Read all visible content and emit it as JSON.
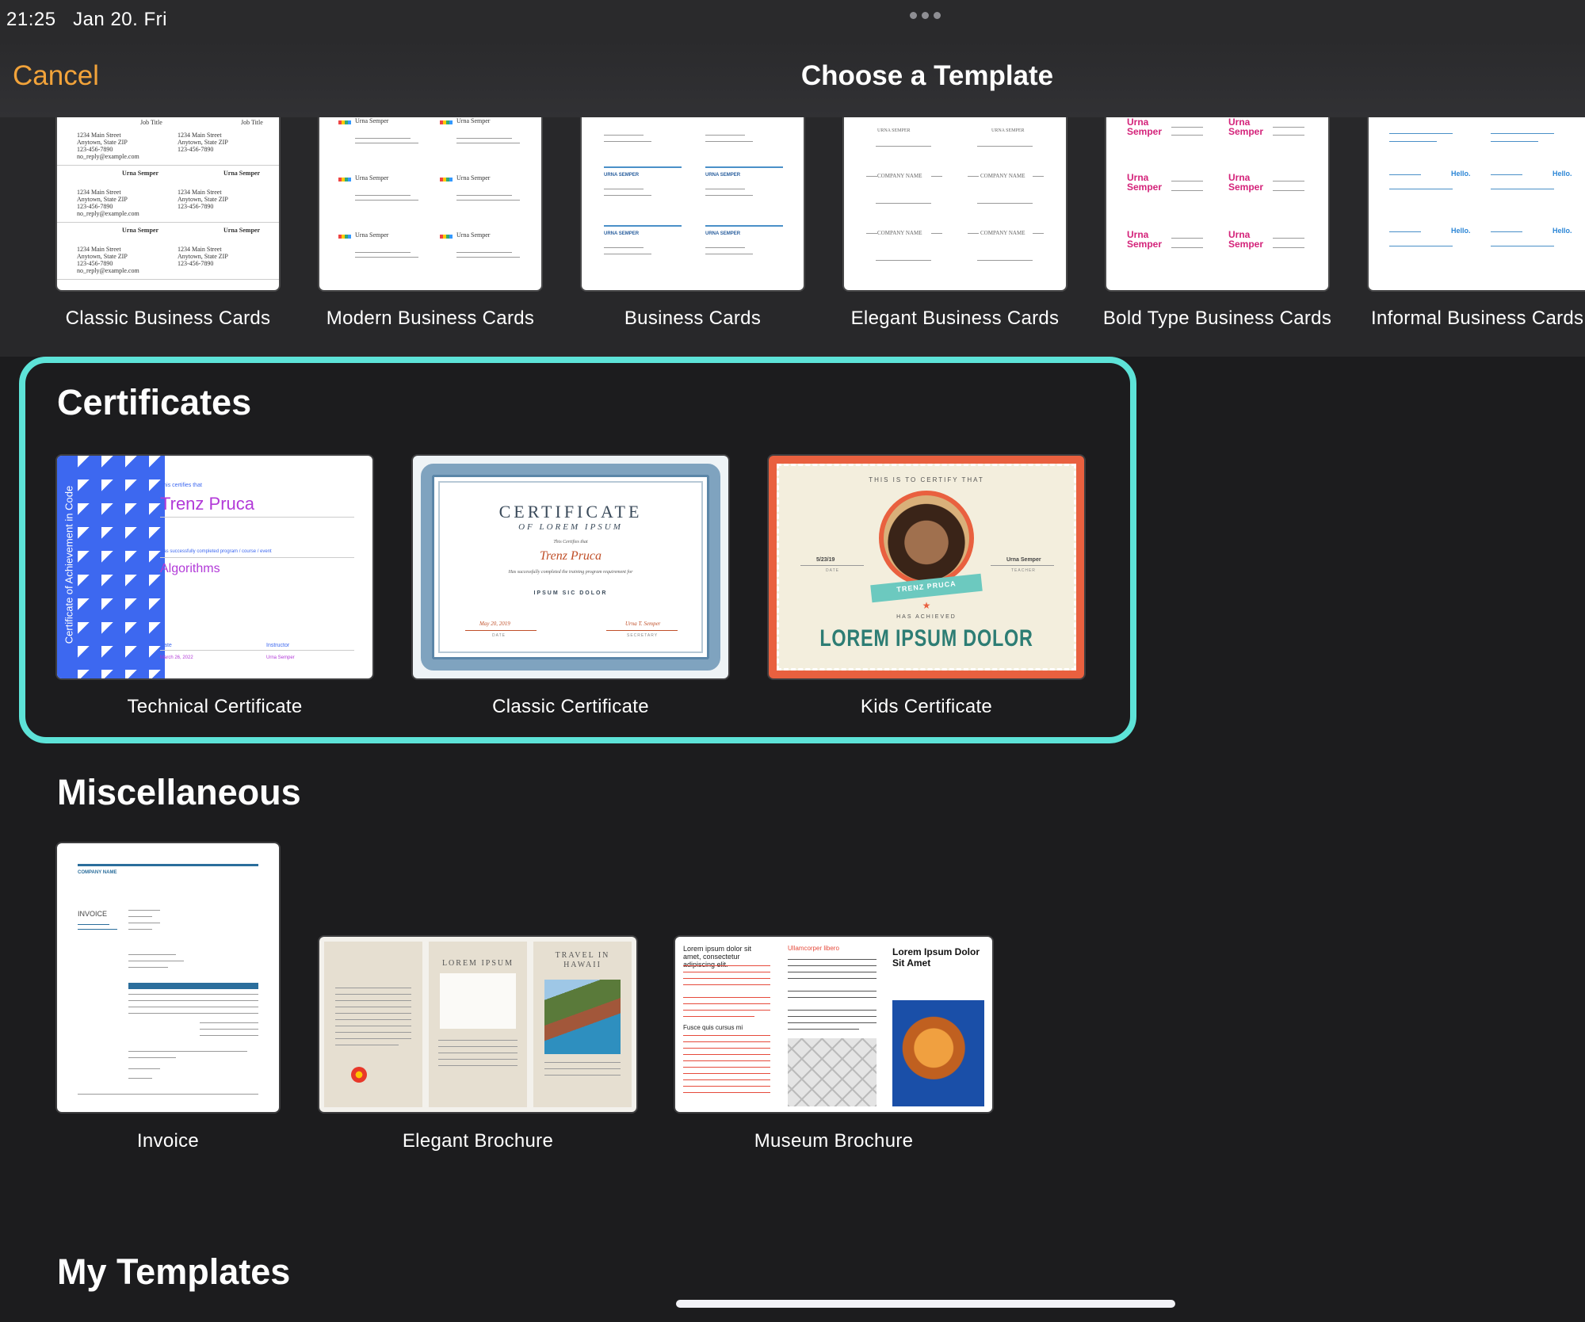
{
  "status": {
    "time": "21:25",
    "date": "Jan 20. Fri"
  },
  "nav": {
    "cancel_label": "Cancel",
    "title": "Choose a Template"
  },
  "business_cards": {
    "items": [
      {
        "label": "Classic Business Cards"
      },
      {
        "label": "Modern Business Cards"
      },
      {
        "label": "Business Cards"
      },
      {
        "label": "Elegant Business Cards"
      },
      {
        "label": "Bold Type Business Cards"
      },
      {
        "label": "Informal Business Cards"
      }
    ]
  },
  "certificates": {
    "title": "Certificates",
    "items": [
      {
        "label": "Technical Certificate"
      },
      {
        "label": "Classic Certificate"
      },
      {
        "label": "Kids Certificate"
      }
    ],
    "technical": {
      "side_text": "Certificate of Achievement in Code",
      "certifies": "This certifies that",
      "name": "Trenz Pruca",
      "completed": "Has successfully completed program / course / event",
      "course": "Algorithms",
      "date_label": "Date",
      "date_value": "March 26, 2022",
      "instructor_label": "Instructor",
      "instructor_value": "Urna Semper"
    },
    "classic": {
      "heading": "CERTIFICATE",
      "subheading": "OF LOREM IPSUM",
      "certifies": "This Certifies that",
      "name": "Trenz Pruca",
      "completed": "Has successfully completed the training program requirement for",
      "program": "IPSUM SIC DOLOR",
      "date_value": "May 20, 2019",
      "date_label": "DATE",
      "secretary_value": "Urna T. Semper",
      "secretary_label": "SECRETARY"
    },
    "kids": {
      "top": "THIS IS TO CERTIFY THAT",
      "date_value": "5/23/19",
      "date_label": "DATE",
      "teacher_value": "Urna Semper",
      "teacher_label": "TEACHER",
      "ribbon": "TRENZ PRUCA",
      "achieved": "HAS ACHIEVED",
      "headline": "LOREM IPSUM DOLOR"
    }
  },
  "misc": {
    "title": "Miscellaneous",
    "items": [
      {
        "label": "Invoice"
      },
      {
        "label": "Elegant Brochure"
      },
      {
        "label": "Museum Brochure"
      }
    ],
    "invoice": {
      "company": "COMPANY NAME",
      "heading": "INVOICE"
    },
    "elegant": {
      "panel2": "LOREM IPSUM",
      "panel3": "TRAVEL IN HAWAII"
    },
    "museum": {
      "col1": "Lorem ipsum dolor sit amet, consectetur adipiscing elit.",
      "col2": "Ullamcorper libero",
      "col3": "Lorem Ipsum Dolor Sit Amet",
      "sub": "Fusce quis cursus mi"
    }
  },
  "my_templates": {
    "title": "My Templates"
  },
  "colors": {
    "accent": "#f2a33a",
    "highlight": "#5de3d8",
    "background": "#1c1c1e"
  }
}
